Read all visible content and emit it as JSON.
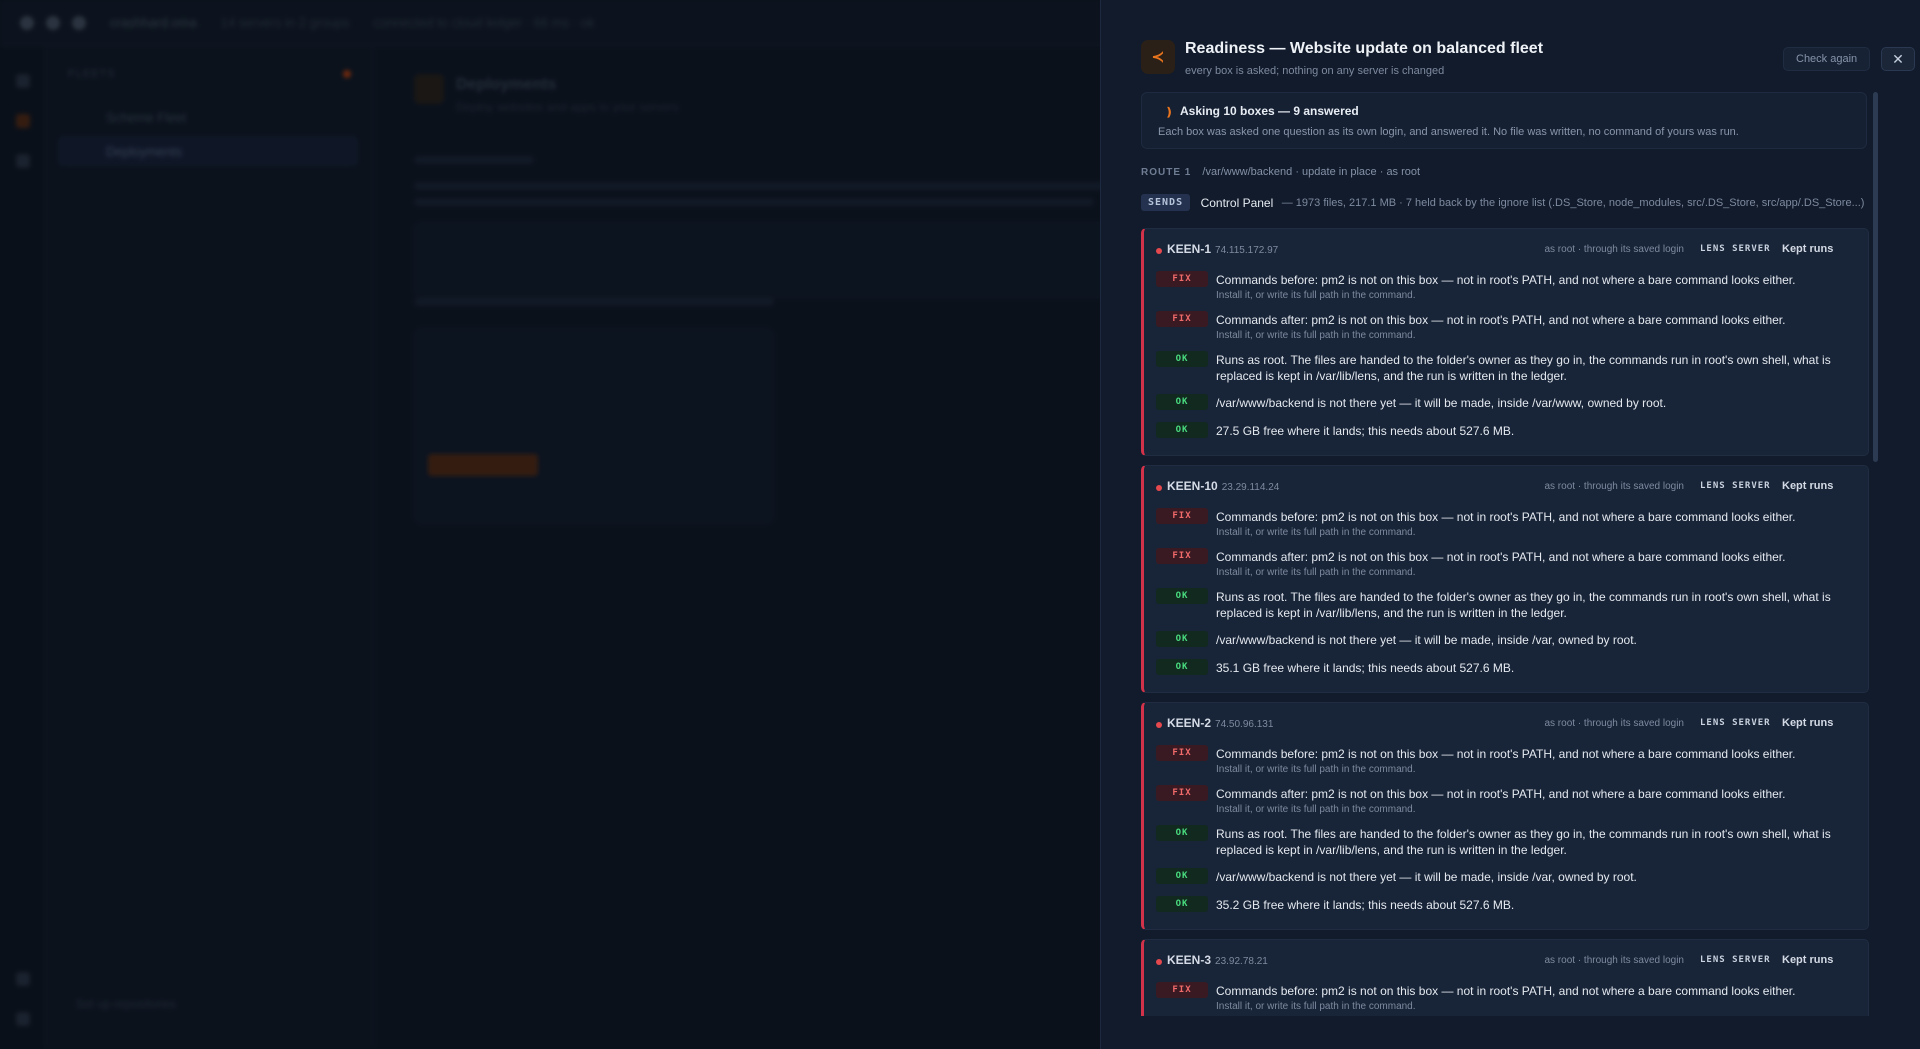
{
  "app": {
    "title": "crashhard.oma",
    "titlebar_crumb_1": "14 servers in 2 groups",
    "titlebar_crumb_2": "connected to cloud ledger · 66 ms · ok",
    "sidebar_heading": "FLEETS",
    "sidebar_items": [
      "Scheme Fleet",
      "Deployments"
    ],
    "sidebar_footer": "Set up repositories",
    "main_title": "Deployments",
    "main_subtitle": "Deploy websites and apps to your servers"
  },
  "drawer": {
    "title": "Readiness — Website update on balanced fleet",
    "subtitle": "every box is asked; nothing on any server is changed",
    "check_again": "Check again",
    "close": "✕",
    "logo_glyph": "≺",
    "status": {
      "spinner": "❫",
      "title": "Asking 10 boxes — 9 answered",
      "detail": "Each box was asked one question as its own login, and answered it. No file was written, no command of yours was run."
    },
    "route": {
      "label": "ROUTE 1",
      "text": "/var/www/backend · update in place · as root"
    },
    "sends": {
      "tag": "SENDS",
      "name": "Control Panel",
      "meta": "— 1973 files, 217.1 MB · 7 held back by the ignore list (.DS_Store, node_modules, src/.DS_Store, src/app/.DS_Store...)"
    },
    "hosts": [
      {
        "name": "KEEN-1",
        "ip": "74.115.172.97",
        "meta": "as root · through its saved login",
        "lens": "LENS SERVER",
        "kept": "Kept runs",
        "checks": [
          {
            "kind": "FIX",
            "text": "Commands before: pm2 is not on this box — not in root's PATH, and not where a bare command looks either.",
            "hint": "Install it, or write its full path in the command."
          },
          {
            "kind": "FIX",
            "text": "Commands after: pm2 is not on this box — not in root's PATH, and not where a bare command looks either.",
            "hint": "Install it, or write its full path in the command."
          },
          {
            "kind": "OK",
            "text": "Runs as root. The files are handed to the folder's owner as they go in, the commands run in root's own shell, what is replaced is kept in /var/lib/lens, and the run is written in the ledger.",
            "hint": ""
          },
          {
            "kind": "OK",
            "text": "/var/www/backend is not there yet — it will be made, inside /var/www, owned by root.",
            "hint": ""
          },
          {
            "kind": "OK",
            "text": "27.5 GB free where it lands; this needs about 527.6 MB.",
            "hint": ""
          }
        ]
      },
      {
        "name": "KEEN-10",
        "ip": "23.29.114.24",
        "meta": "as root · through its saved login",
        "lens": "LENS SERVER",
        "kept": "Kept runs",
        "checks": [
          {
            "kind": "FIX",
            "text": "Commands before: pm2 is not on this box — not in root's PATH, and not where a bare command looks either.",
            "hint": "Install it, or write its full path in the command."
          },
          {
            "kind": "FIX",
            "text": "Commands after: pm2 is not on this box — not in root's PATH, and not where a bare command looks either.",
            "hint": "Install it, or write its full path in the command."
          },
          {
            "kind": "OK",
            "text": "Runs as root. The files are handed to the folder's owner as they go in, the commands run in root's own shell, what is replaced is kept in /var/lib/lens, and the run is written in the ledger.",
            "hint": ""
          },
          {
            "kind": "OK",
            "text": "/var/www/backend is not there yet — it will be made, inside /var, owned by root.",
            "hint": ""
          },
          {
            "kind": "OK",
            "text": "35.1 GB free where it lands; this needs about 527.6 MB.",
            "hint": ""
          }
        ]
      },
      {
        "name": "KEEN-2",
        "ip": "74.50.96.131",
        "meta": "as root · through its saved login",
        "lens": "LENS SERVER",
        "kept": "Kept runs",
        "checks": [
          {
            "kind": "FIX",
            "text": "Commands before: pm2 is not on this box — not in root's PATH, and not where a bare command looks either.",
            "hint": "Install it, or write its full path in the command."
          },
          {
            "kind": "FIX",
            "text": "Commands after: pm2 is not on this box — not in root's PATH, and not where a bare command looks either.",
            "hint": "Install it, or write its full path in the command."
          },
          {
            "kind": "OK",
            "text": "Runs as root. The files are handed to the folder's owner as they go in, the commands run in root's own shell, what is replaced is kept in /var/lib/lens, and the run is written in the ledger.",
            "hint": ""
          },
          {
            "kind": "OK",
            "text": "/var/www/backend is not there yet — it will be made, inside /var, owned by root.",
            "hint": ""
          },
          {
            "kind": "OK",
            "text": "35.2 GB free where it lands; this needs about 527.6 MB.",
            "hint": ""
          }
        ]
      },
      {
        "name": "KEEN-3",
        "ip": "23.92.78.21",
        "meta": "as root · through its saved login",
        "lens": "LENS SERVER",
        "kept": "Kept runs",
        "checks": [
          {
            "kind": "FIX",
            "text": "Commands before: pm2 is not on this box — not in root's PATH, and not where a bare command looks either.",
            "hint": "Install it, or write its full path in the command."
          }
        ]
      }
    ]
  },
  "colors": {
    "accent": "#e8741e",
    "fix": "#f26b6b",
    "ok": "#4ade80",
    "host_stripe": "#d2334a"
  }
}
